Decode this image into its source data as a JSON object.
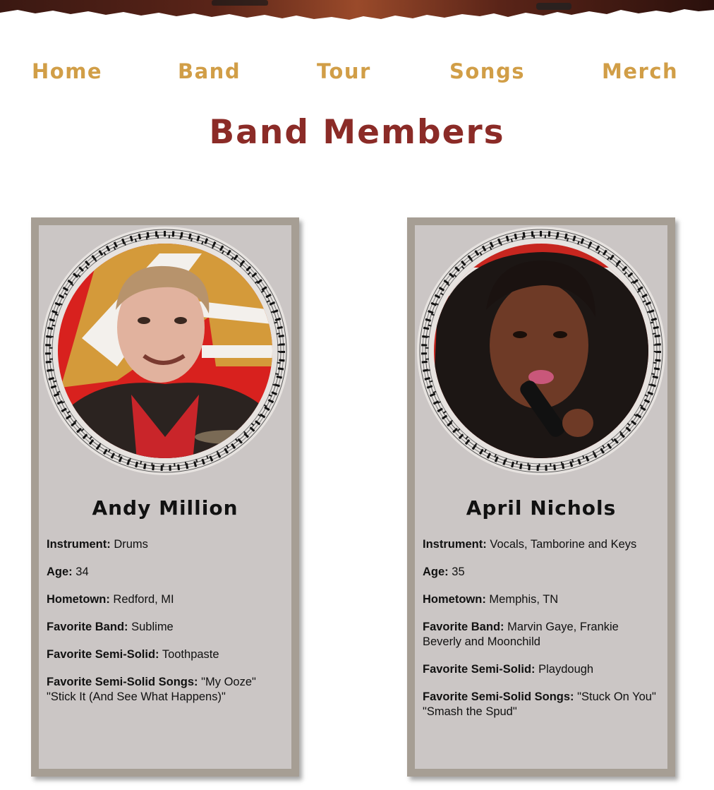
{
  "nav": {
    "items": [
      {
        "label": "Home"
      },
      {
        "label": "Band"
      },
      {
        "label": "Tour"
      },
      {
        "label": "Songs"
      },
      {
        "label": "Merch"
      }
    ]
  },
  "page": {
    "title": "Band Members"
  },
  "colors": {
    "nav": "#d19e47",
    "title": "#8b2b27",
    "card_bg": "#cbc6c5",
    "card_border": "#a69e94"
  },
  "members": [
    {
      "name": "Andy Million",
      "facts": [
        {
          "label": "Instrument:",
          "value": "Drums"
        },
        {
          "label": "Age:",
          "value": "34"
        },
        {
          "label": "Hometown:",
          "value": "Redford, MI"
        },
        {
          "label": "Favorite Band:",
          "value": "Sublime"
        },
        {
          "label": "Favorite Semi-Solid:",
          "value": "Toothpaste"
        },
        {
          "label": "Favorite Semi-Solid Songs:",
          "value": "\"My Ooze\" \"Stick It (And See What Happens)\""
        }
      ]
    },
    {
      "name": "April Nichols",
      "facts": [
        {
          "label": "Instrument:",
          "value": "Vocals, Tamborine and Keys"
        },
        {
          "label": "Age:",
          "value": "35"
        },
        {
          "label": "Hometown:",
          "value": "Memphis, TN"
        },
        {
          "label": "Favorite Band:",
          "value": "Marvin Gaye, Frankie Beverly and Moonchild"
        },
        {
          "label": "Favorite Semi-Solid:",
          "value": "Playdough"
        },
        {
          "label": "Favorite Semi-Solid Songs:",
          "value": "\"Stuck On You\" \"Smash the Spud\""
        }
      ]
    }
  ]
}
